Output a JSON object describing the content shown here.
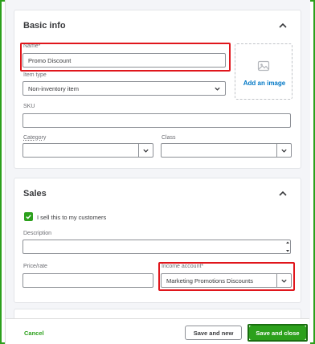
{
  "basic_info": {
    "title": "Basic info",
    "name_label": "Name*",
    "name_value": "Promo Discount",
    "add_image_label": "Add an image",
    "item_type_label": "Item type",
    "item_type_value": "Non-inventory item",
    "sku_label": "SKU",
    "sku_value": "",
    "category_label": "Category",
    "category_value": "",
    "class_label": "Class",
    "class_value": ""
  },
  "sales": {
    "title": "Sales",
    "sell_checkbox_label": "I sell this to my customers",
    "sell_checked": true,
    "description_label": "Description",
    "description_value": "",
    "price_label": "Price/rate",
    "price_value": "",
    "income_account_label": "Income account*",
    "income_account_value": "Marketing Promotions Discounts"
  },
  "footer": {
    "cancel_label": "Cancel",
    "save_new_label": "Save and new",
    "save_close_label": "Save and close"
  },
  "colors": {
    "accent_green": "#2ca01c",
    "highlight_red": "#e0161c",
    "link_blue": "#0077c5"
  }
}
